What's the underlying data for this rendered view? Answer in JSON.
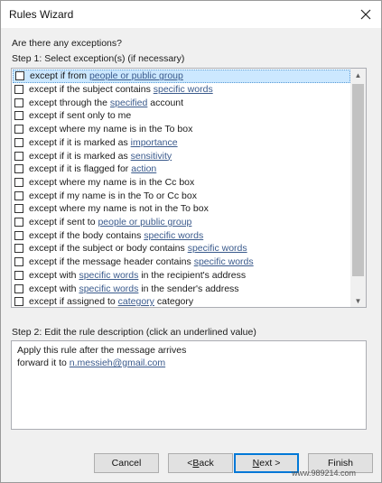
{
  "window": {
    "title": "Rules Wizard",
    "close_icon": "close-icon"
  },
  "question": "Are there any exceptions?",
  "step1_label": "Step 1: Select exception(s) (if necessary)",
  "exceptions": [
    {
      "pre": "except if from ",
      "link": "people or public group",
      "post": "",
      "selected": true
    },
    {
      "pre": "except if the subject contains ",
      "link": "specific words",
      "post": ""
    },
    {
      "pre": "except through the ",
      "link": "specified",
      "post": " account"
    },
    {
      "pre": "except if sent only to me",
      "link": "",
      "post": ""
    },
    {
      "pre": "except where my name is in the To box",
      "link": "",
      "post": ""
    },
    {
      "pre": "except if it is marked as ",
      "link": "importance",
      "post": ""
    },
    {
      "pre": "except if it is marked as ",
      "link": "sensitivity",
      "post": ""
    },
    {
      "pre": "except if it is flagged for ",
      "link": "action",
      "post": ""
    },
    {
      "pre": "except where my name is in the Cc box",
      "link": "",
      "post": ""
    },
    {
      "pre": "except if my name is in the To or Cc box",
      "link": "",
      "post": ""
    },
    {
      "pre": "except where my name is not in the To box",
      "link": "",
      "post": ""
    },
    {
      "pre": "except if sent to ",
      "link": "people or public group",
      "post": ""
    },
    {
      "pre": "except if the body contains ",
      "link": "specific words",
      "post": ""
    },
    {
      "pre": "except if the subject or body contains ",
      "link": "specific words",
      "post": ""
    },
    {
      "pre": "except if the message header contains ",
      "link": "specific words",
      "post": ""
    },
    {
      "pre": "except with ",
      "link": "specific words",
      "post": " in the recipient's address"
    },
    {
      "pre": "except with ",
      "link": "specific words",
      "post": " in the sender's address"
    },
    {
      "pre": "except if assigned to ",
      "link": "category",
      "post": " category"
    }
  ],
  "scrollbar": {
    "up_glyph": "▲",
    "down_glyph": "▼"
  },
  "step2_label": "Step 2: Edit the rule description (click an underlined value)",
  "description": {
    "line1": "Apply this rule after the message arrives",
    "line2_pre": "forward it to ",
    "line2_link": "n.messieh@gmail.com"
  },
  "buttons": {
    "cancel": "Cancel",
    "back_prefix": "< ",
    "back_mnemonic": "B",
    "back_rest": "ack",
    "next_mnemonic": "N",
    "next_rest": "ext >",
    "finish": "Finish"
  },
  "watermark": "www.989214.com"
}
